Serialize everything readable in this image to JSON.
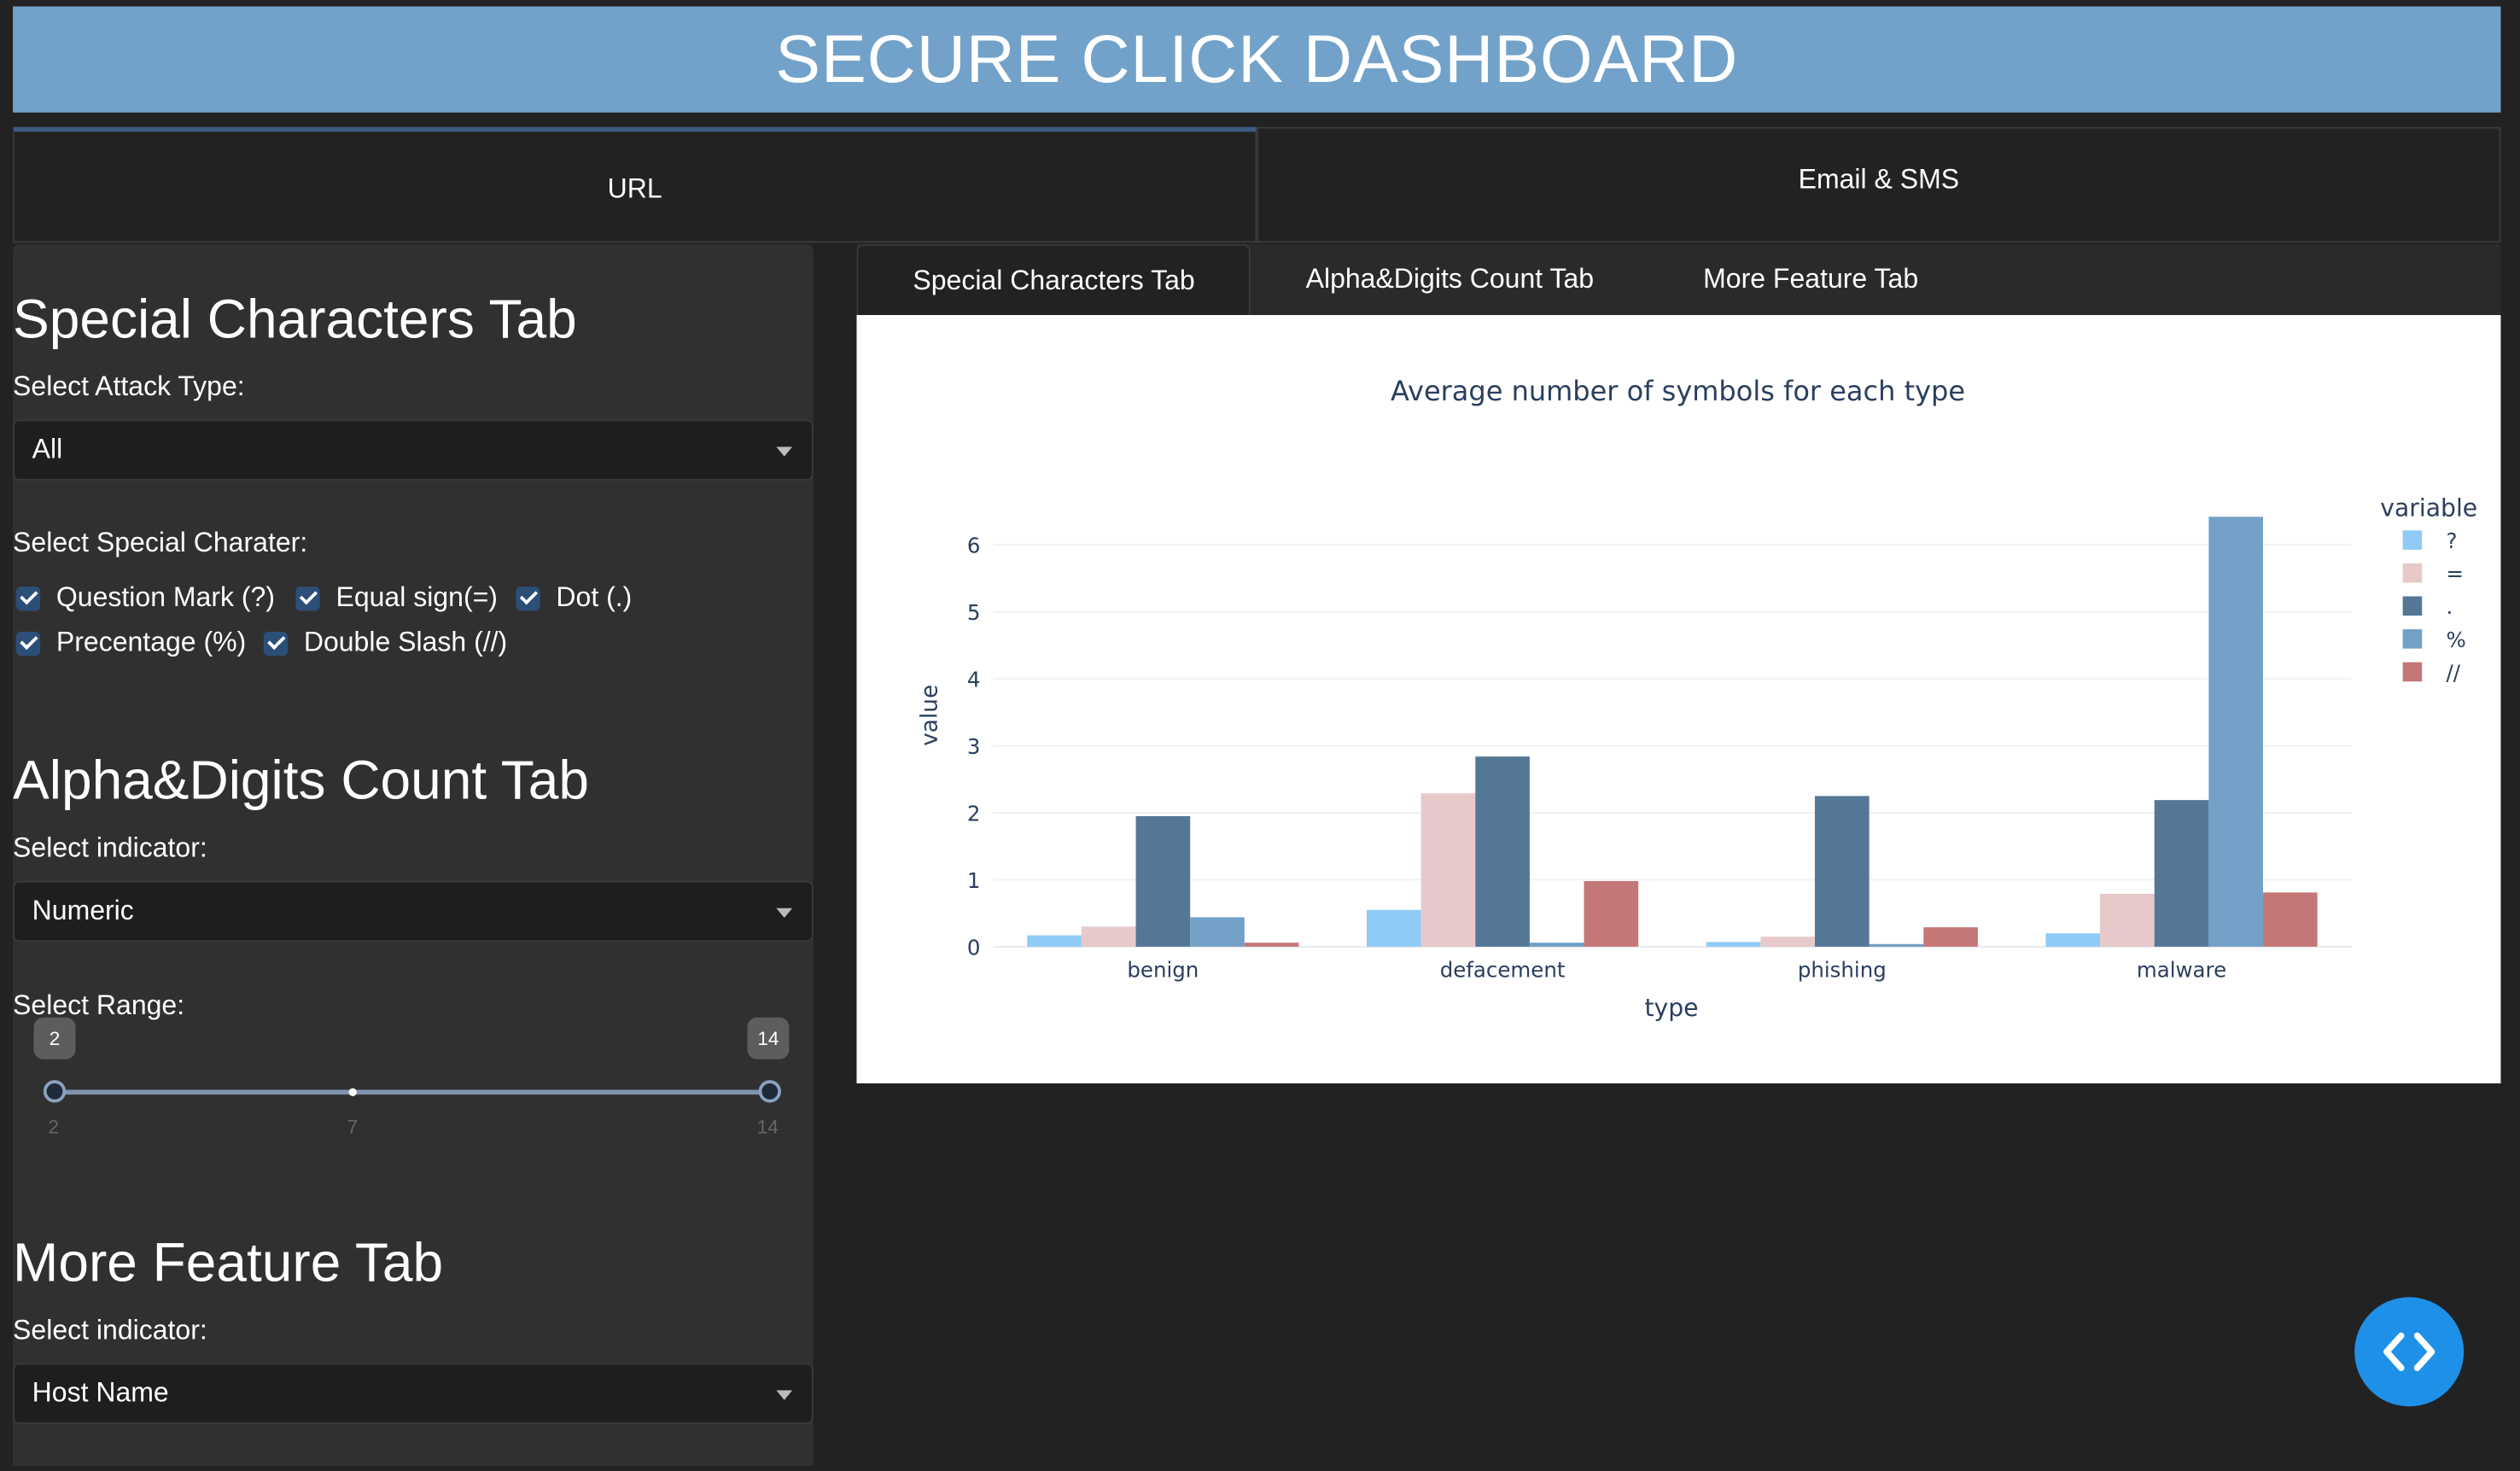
{
  "header": {
    "title": "SECURE CLICK DASHBOARD"
  },
  "top_tabs": [
    {
      "label": "URL",
      "active": true
    },
    {
      "label": "Email & SMS",
      "active": false
    }
  ],
  "sidebar": {
    "special": {
      "title": "Special Characters Tab",
      "attack_label": "Select Attack Type:",
      "attack_value": "All",
      "char_label": "Select Special Charater:",
      "checkboxes": [
        {
          "label": "Question Mark (?)",
          "checked": true
        },
        {
          "label": "Equal sign(=)",
          "checked": true
        },
        {
          "label": "Dot (.)",
          "checked": true
        },
        {
          "label": "Precentage (%)",
          "checked": true
        },
        {
          "label": "Double Slash (//)",
          "checked": true
        }
      ]
    },
    "alpha": {
      "title": "Alpha&Digits Count Tab",
      "indicator_label": "Select indicator:",
      "indicator_value": "Numeric",
      "range_label": "Select Range:",
      "range_low": "2",
      "range_high": "14",
      "range_ticks": [
        "2",
        "7",
        "14"
      ]
    },
    "more": {
      "title": "More Feature Tab",
      "indicator_label": "Select indicator:",
      "indicator_value": "Host Name"
    }
  },
  "inner_tabs": [
    {
      "label": "Special Characters Tab",
      "active": true
    },
    {
      "label": "Alpha&Digits Count Tab",
      "active": false
    },
    {
      "label": "More Feature Tab",
      "active": false
    }
  ],
  "chart_data": {
    "type": "bar",
    "title": "Average number of symbols for each type",
    "xlabel": "type",
    "ylabel": "value",
    "categories": [
      "benign",
      "defacement",
      "phishing",
      "malware"
    ],
    "ylim": [
      0,
      6.6
    ],
    "yticks": [
      0,
      1,
      2,
      3,
      4,
      5,
      6
    ],
    "grid": true,
    "legend_title": "variable",
    "legend_position": "right",
    "series": [
      {
        "name": "?",
        "color": "#8fcbf6",
        "values": [
          0.17,
          0.55,
          0.07,
          0.2
        ]
      },
      {
        "name": "=",
        "color": "#e7c9ca",
        "values": [
          0.3,
          2.29,
          0.15,
          0.79
        ]
      },
      {
        "name": ".",
        "color": "#557796",
        "values": [
          1.95,
          2.84,
          2.25,
          2.19
        ]
      },
      {
        "name": "%",
        "color": "#73a0c6",
        "values": [
          0.44,
          0.06,
          0.04,
          6.42
        ]
      },
      {
        "name": "//",
        "color": "#c57777",
        "values": [
          0.06,
          0.98,
          0.29,
          0.81
        ]
      }
    ]
  },
  "fab": {
    "icon": "code-icon"
  }
}
